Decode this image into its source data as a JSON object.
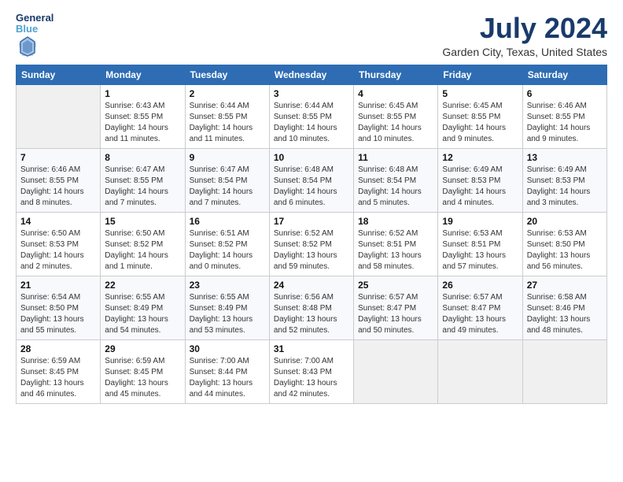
{
  "header": {
    "logo_line1": "General",
    "logo_line2": "Blue",
    "month": "July 2024",
    "location": "Garden City, Texas, United States"
  },
  "weekdays": [
    "Sunday",
    "Monday",
    "Tuesday",
    "Wednesday",
    "Thursday",
    "Friday",
    "Saturday"
  ],
  "weeks": [
    [
      {
        "day": "",
        "info": ""
      },
      {
        "day": "1",
        "info": "Sunrise: 6:43 AM\nSunset: 8:55 PM\nDaylight: 14 hours\nand 11 minutes."
      },
      {
        "day": "2",
        "info": "Sunrise: 6:44 AM\nSunset: 8:55 PM\nDaylight: 14 hours\nand 11 minutes."
      },
      {
        "day": "3",
        "info": "Sunrise: 6:44 AM\nSunset: 8:55 PM\nDaylight: 14 hours\nand 10 minutes."
      },
      {
        "day": "4",
        "info": "Sunrise: 6:45 AM\nSunset: 8:55 PM\nDaylight: 14 hours\nand 10 minutes."
      },
      {
        "day": "5",
        "info": "Sunrise: 6:45 AM\nSunset: 8:55 PM\nDaylight: 14 hours\nand 9 minutes."
      },
      {
        "day": "6",
        "info": "Sunrise: 6:46 AM\nSunset: 8:55 PM\nDaylight: 14 hours\nand 9 minutes."
      }
    ],
    [
      {
        "day": "7",
        "info": "Sunrise: 6:46 AM\nSunset: 8:55 PM\nDaylight: 14 hours\nand 8 minutes."
      },
      {
        "day": "8",
        "info": "Sunrise: 6:47 AM\nSunset: 8:55 PM\nDaylight: 14 hours\nand 7 minutes."
      },
      {
        "day": "9",
        "info": "Sunrise: 6:47 AM\nSunset: 8:54 PM\nDaylight: 14 hours\nand 7 minutes."
      },
      {
        "day": "10",
        "info": "Sunrise: 6:48 AM\nSunset: 8:54 PM\nDaylight: 14 hours\nand 6 minutes."
      },
      {
        "day": "11",
        "info": "Sunrise: 6:48 AM\nSunset: 8:54 PM\nDaylight: 14 hours\nand 5 minutes."
      },
      {
        "day": "12",
        "info": "Sunrise: 6:49 AM\nSunset: 8:53 PM\nDaylight: 14 hours\nand 4 minutes."
      },
      {
        "day": "13",
        "info": "Sunrise: 6:49 AM\nSunset: 8:53 PM\nDaylight: 14 hours\nand 3 minutes."
      }
    ],
    [
      {
        "day": "14",
        "info": "Sunrise: 6:50 AM\nSunset: 8:53 PM\nDaylight: 14 hours\nand 2 minutes."
      },
      {
        "day": "15",
        "info": "Sunrise: 6:50 AM\nSunset: 8:52 PM\nDaylight: 14 hours\nand 1 minute."
      },
      {
        "day": "16",
        "info": "Sunrise: 6:51 AM\nSunset: 8:52 PM\nDaylight: 14 hours\nand 0 minutes."
      },
      {
        "day": "17",
        "info": "Sunrise: 6:52 AM\nSunset: 8:52 PM\nDaylight: 13 hours\nand 59 minutes."
      },
      {
        "day": "18",
        "info": "Sunrise: 6:52 AM\nSunset: 8:51 PM\nDaylight: 13 hours\nand 58 minutes."
      },
      {
        "day": "19",
        "info": "Sunrise: 6:53 AM\nSunset: 8:51 PM\nDaylight: 13 hours\nand 57 minutes."
      },
      {
        "day": "20",
        "info": "Sunrise: 6:53 AM\nSunset: 8:50 PM\nDaylight: 13 hours\nand 56 minutes."
      }
    ],
    [
      {
        "day": "21",
        "info": "Sunrise: 6:54 AM\nSunset: 8:50 PM\nDaylight: 13 hours\nand 55 minutes."
      },
      {
        "day": "22",
        "info": "Sunrise: 6:55 AM\nSunset: 8:49 PM\nDaylight: 13 hours\nand 54 minutes."
      },
      {
        "day": "23",
        "info": "Sunrise: 6:55 AM\nSunset: 8:49 PM\nDaylight: 13 hours\nand 53 minutes."
      },
      {
        "day": "24",
        "info": "Sunrise: 6:56 AM\nSunset: 8:48 PM\nDaylight: 13 hours\nand 52 minutes."
      },
      {
        "day": "25",
        "info": "Sunrise: 6:57 AM\nSunset: 8:47 PM\nDaylight: 13 hours\nand 50 minutes."
      },
      {
        "day": "26",
        "info": "Sunrise: 6:57 AM\nSunset: 8:47 PM\nDaylight: 13 hours\nand 49 minutes."
      },
      {
        "day": "27",
        "info": "Sunrise: 6:58 AM\nSunset: 8:46 PM\nDaylight: 13 hours\nand 48 minutes."
      }
    ],
    [
      {
        "day": "28",
        "info": "Sunrise: 6:59 AM\nSunset: 8:45 PM\nDaylight: 13 hours\nand 46 minutes."
      },
      {
        "day": "29",
        "info": "Sunrise: 6:59 AM\nSunset: 8:45 PM\nDaylight: 13 hours\nand 45 minutes."
      },
      {
        "day": "30",
        "info": "Sunrise: 7:00 AM\nSunset: 8:44 PM\nDaylight: 13 hours\nand 44 minutes."
      },
      {
        "day": "31",
        "info": "Sunrise: 7:00 AM\nSunset: 8:43 PM\nDaylight: 13 hours\nand 42 minutes."
      },
      {
        "day": "",
        "info": ""
      },
      {
        "day": "",
        "info": ""
      },
      {
        "day": "",
        "info": ""
      }
    ]
  ]
}
